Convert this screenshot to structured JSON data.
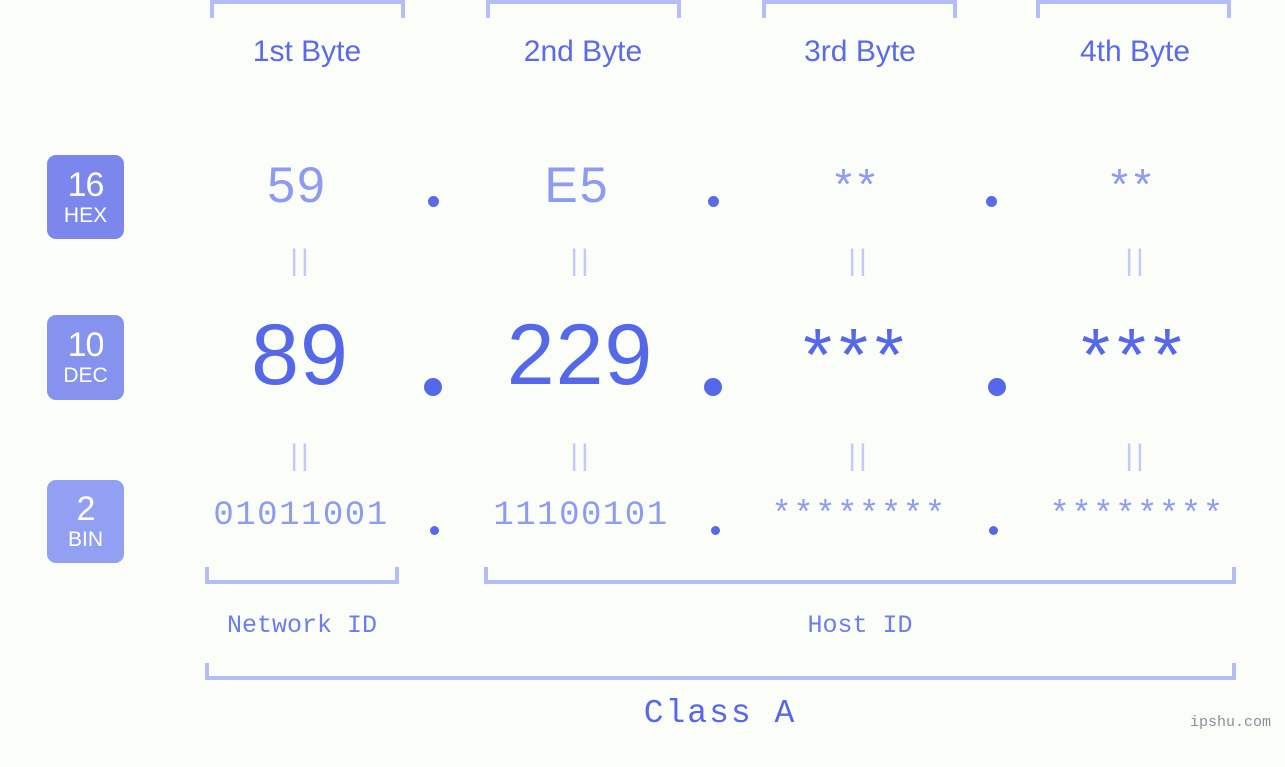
{
  "page": {
    "background_color": "#fbfdf8",
    "accent_color": "#5668ea",
    "accent_light_color": "#8e9bf2",
    "bracket_color": "#b4bdf7",
    "watermark": "ipshu.com"
  },
  "byte_headers": [
    {
      "label": "1st Byte"
    },
    {
      "label": "2nd Byte"
    },
    {
      "label": "3rd Byte"
    },
    {
      "label": "4th Byte"
    }
  ],
  "bases": [
    {
      "number": "16",
      "name": "HEX",
      "color": "#7b87ec"
    },
    {
      "number": "10",
      "name": "DEC",
      "color": "#8592ee"
    },
    {
      "number": "2",
      "name": "BIN",
      "color": "#92a0f4"
    }
  ],
  "rows": {
    "hex": {
      "base_number": "16",
      "base_name": "HEX",
      "values": [
        "59",
        "E5",
        "**",
        "**"
      ],
      "separator": "."
    },
    "dec": {
      "base_number": "10",
      "base_name": "DEC",
      "values": [
        "89",
        "229",
        "***",
        "***"
      ],
      "separator": "."
    },
    "bin": {
      "base_number": "2",
      "base_name": "BIN",
      "values": [
        "01011001",
        "11100101",
        "********",
        "********"
      ],
      "separator": "."
    }
  },
  "equals_marks": {
    "glyph": "||",
    "count_per_gap": 4
  },
  "segments": {
    "network_id": {
      "label": "Network ID"
    },
    "host_id": {
      "label": "Host ID"
    },
    "class": {
      "label": "Class A"
    }
  }
}
